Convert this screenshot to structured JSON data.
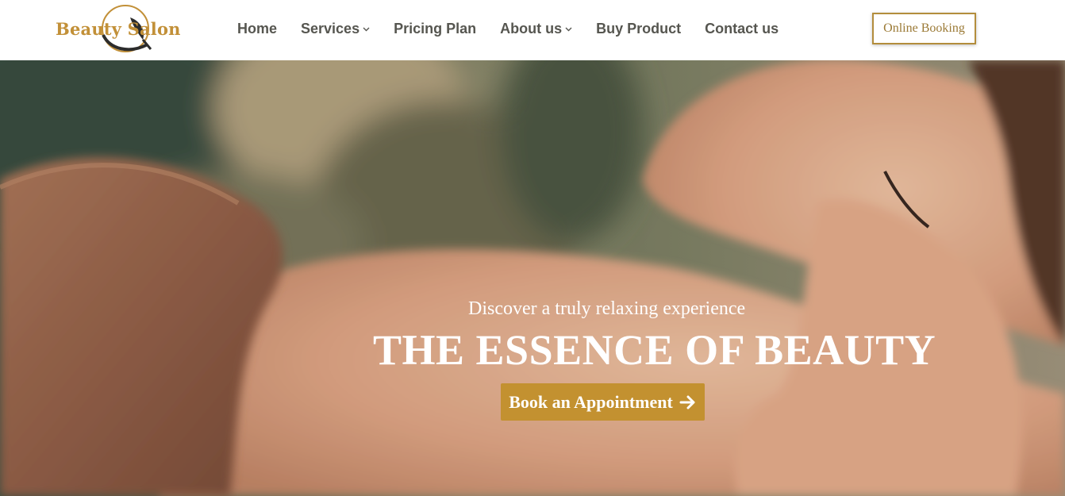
{
  "brand": {
    "logo_text": "Beauty Salon",
    "accent_color": "#c39130"
  },
  "nav": {
    "items": [
      {
        "label": "Home",
        "has_dropdown": false
      },
      {
        "label": "Services",
        "has_dropdown": true
      },
      {
        "label": "Pricing Plan",
        "has_dropdown": false
      },
      {
        "label": "About us",
        "has_dropdown": true
      },
      {
        "label": "Buy Product",
        "has_dropdown": false
      },
      {
        "label": "Contact us",
        "has_dropdown": false
      }
    ]
  },
  "header": {
    "booking_label": "Online Booking"
  },
  "hero": {
    "tagline": "Discover a truly relaxing experience",
    "title": "THE ESSENCE OF BEAUTY",
    "cta_label": "Book an Appointment",
    "cta_icon": "arrow-right-icon"
  }
}
